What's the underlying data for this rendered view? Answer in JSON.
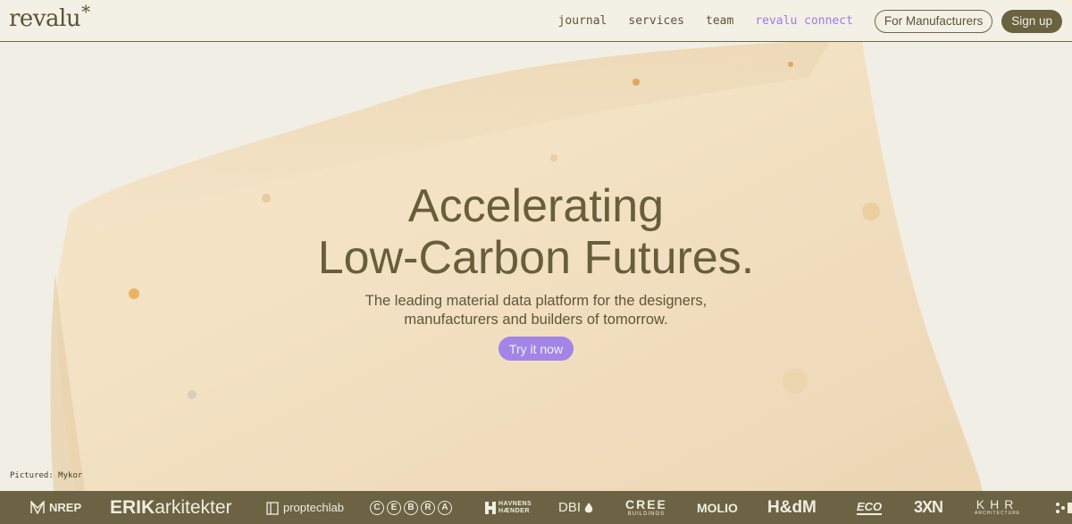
{
  "brand": {
    "name": "revalu",
    "mark": "*"
  },
  "nav": {
    "links": [
      "journal",
      "services",
      "team",
      "revalu connect"
    ],
    "manufacturers_button": "For Manufacturers",
    "signup_button": "Sign up"
  },
  "hero": {
    "headline_line1": "Accelerating",
    "headline_line2": "Low-Carbon Futures.",
    "sub_line1": "The leading material data platform for the designers,",
    "sub_line2": "manufacturers and builders of tomorrow.",
    "cta": "Try it now",
    "caption": "Pictured: Mykor"
  },
  "partners": {
    "items": [
      "NREP",
      "ERIK",
      "arkitekter",
      "proptechlab",
      "C",
      "E",
      "B",
      "R",
      "A",
      "HAVNENS",
      "HÆNDER",
      "DBI",
      "CREE",
      "BUILDINGS",
      "MOLIO",
      "H&dM",
      "ECO",
      "3XN",
      "KHR",
      "ARCHITECTURE"
    ]
  },
  "colors": {
    "background": "#f2efe6",
    "text": "#5c5435",
    "accent": "#a385e5",
    "strip": "#6b6343"
  }
}
